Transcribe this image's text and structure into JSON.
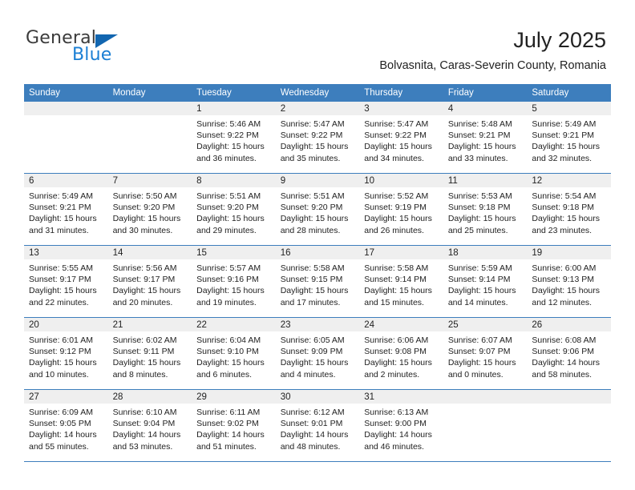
{
  "logo": {
    "word_one": "General",
    "word_two": "Blue",
    "triangle_color": "#1266b0",
    "blue_text_color": "#1b7fd4"
  },
  "header": {
    "title": "July 2025",
    "subtitle": "Bolvasnita, Caras-Severin County, Romania"
  },
  "theme": {
    "header_blue": "#3d7ebd",
    "date_band_gray": "#efefef",
    "text": "#222222"
  },
  "calendar": {
    "day_headers": [
      "Sunday",
      "Monday",
      "Tuesday",
      "Wednesday",
      "Thursday",
      "Friday",
      "Saturday"
    ],
    "weeks": [
      [
        {
          "day": "",
          "empty": true,
          "sunrise": "",
          "sunset": "",
          "daylight_a": "",
          "daylight_b": ""
        },
        {
          "day": "",
          "empty": true,
          "sunrise": "",
          "sunset": "",
          "daylight_a": "",
          "daylight_b": ""
        },
        {
          "day": "1",
          "empty": false,
          "sunrise": "Sunrise: 5:46 AM",
          "sunset": "Sunset: 9:22 PM",
          "daylight_a": "Daylight: 15 hours",
          "daylight_b": "and 36 minutes."
        },
        {
          "day": "2",
          "empty": false,
          "sunrise": "Sunrise: 5:47 AM",
          "sunset": "Sunset: 9:22 PM",
          "daylight_a": "Daylight: 15 hours",
          "daylight_b": "and 35 minutes."
        },
        {
          "day": "3",
          "empty": false,
          "sunrise": "Sunrise: 5:47 AM",
          "sunset": "Sunset: 9:22 PM",
          "daylight_a": "Daylight: 15 hours",
          "daylight_b": "and 34 minutes."
        },
        {
          "day": "4",
          "empty": false,
          "sunrise": "Sunrise: 5:48 AM",
          "sunset": "Sunset: 9:21 PM",
          "daylight_a": "Daylight: 15 hours",
          "daylight_b": "and 33 minutes."
        },
        {
          "day": "5",
          "empty": false,
          "sunrise": "Sunrise: 5:49 AM",
          "sunset": "Sunset: 9:21 PM",
          "daylight_a": "Daylight: 15 hours",
          "daylight_b": "and 32 minutes."
        }
      ],
      [
        {
          "day": "6",
          "empty": false,
          "sunrise": "Sunrise: 5:49 AM",
          "sunset": "Sunset: 9:21 PM",
          "daylight_a": "Daylight: 15 hours",
          "daylight_b": "and 31 minutes."
        },
        {
          "day": "7",
          "empty": false,
          "sunrise": "Sunrise: 5:50 AM",
          "sunset": "Sunset: 9:20 PM",
          "daylight_a": "Daylight: 15 hours",
          "daylight_b": "and 30 minutes."
        },
        {
          "day": "8",
          "empty": false,
          "sunrise": "Sunrise: 5:51 AM",
          "sunset": "Sunset: 9:20 PM",
          "daylight_a": "Daylight: 15 hours",
          "daylight_b": "and 29 minutes."
        },
        {
          "day": "9",
          "empty": false,
          "sunrise": "Sunrise: 5:51 AM",
          "sunset": "Sunset: 9:20 PM",
          "daylight_a": "Daylight: 15 hours",
          "daylight_b": "and 28 minutes."
        },
        {
          "day": "10",
          "empty": false,
          "sunrise": "Sunrise: 5:52 AM",
          "sunset": "Sunset: 9:19 PM",
          "daylight_a": "Daylight: 15 hours",
          "daylight_b": "and 26 minutes."
        },
        {
          "day": "11",
          "empty": false,
          "sunrise": "Sunrise: 5:53 AM",
          "sunset": "Sunset: 9:18 PM",
          "daylight_a": "Daylight: 15 hours",
          "daylight_b": "and 25 minutes."
        },
        {
          "day": "12",
          "empty": false,
          "sunrise": "Sunrise: 5:54 AM",
          "sunset": "Sunset: 9:18 PM",
          "daylight_a": "Daylight: 15 hours",
          "daylight_b": "and 23 minutes."
        }
      ],
      [
        {
          "day": "13",
          "empty": false,
          "sunrise": "Sunrise: 5:55 AM",
          "sunset": "Sunset: 9:17 PM",
          "daylight_a": "Daylight: 15 hours",
          "daylight_b": "and 22 minutes."
        },
        {
          "day": "14",
          "empty": false,
          "sunrise": "Sunrise: 5:56 AM",
          "sunset": "Sunset: 9:17 PM",
          "daylight_a": "Daylight: 15 hours",
          "daylight_b": "and 20 minutes."
        },
        {
          "day": "15",
          "empty": false,
          "sunrise": "Sunrise: 5:57 AM",
          "sunset": "Sunset: 9:16 PM",
          "daylight_a": "Daylight: 15 hours",
          "daylight_b": "and 19 minutes."
        },
        {
          "day": "16",
          "empty": false,
          "sunrise": "Sunrise: 5:58 AM",
          "sunset": "Sunset: 9:15 PM",
          "daylight_a": "Daylight: 15 hours",
          "daylight_b": "and 17 minutes."
        },
        {
          "day": "17",
          "empty": false,
          "sunrise": "Sunrise: 5:58 AM",
          "sunset": "Sunset: 9:14 PM",
          "daylight_a": "Daylight: 15 hours",
          "daylight_b": "and 15 minutes."
        },
        {
          "day": "18",
          "empty": false,
          "sunrise": "Sunrise: 5:59 AM",
          "sunset": "Sunset: 9:14 PM",
          "daylight_a": "Daylight: 15 hours",
          "daylight_b": "and 14 minutes."
        },
        {
          "day": "19",
          "empty": false,
          "sunrise": "Sunrise: 6:00 AM",
          "sunset": "Sunset: 9:13 PM",
          "daylight_a": "Daylight: 15 hours",
          "daylight_b": "and 12 minutes."
        }
      ],
      [
        {
          "day": "20",
          "empty": false,
          "sunrise": "Sunrise: 6:01 AM",
          "sunset": "Sunset: 9:12 PM",
          "daylight_a": "Daylight: 15 hours",
          "daylight_b": "and 10 minutes."
        },
        {
          "day": "21",
          "empty": false,
          "sunrise": "Sunrise: 6:02 AM",
          "sunset": "Sunset: 9:11 PM",
          "daylight_a": "Daylight: 15 hours",
          "daylight_b": "and 8 minutes."
        },
        {
          "day": "22",
          "empty": false,
          "sunrise": "Sunrise: 6:04 AM",
          "sunset": "Sunset: 9:10 PM",
          "daylight_a": "Daylight: 15 hours",
          "daylight_b": "and 6 minutes."
        },
        {
          "day": "23",
          "empty": false,
          "sunrise": "Sunrise: 6:05 AM",
          "sunset": "Sunset: 9:09 PM",
          "daylight_a": "Daylight: 15 hours",
          "daylight_b": "and 4 minutes."
        },
        {
          "day": "24",
          "empty": false,
          "sunrise": "Sunrise: 6:06 AM",
          "sunset": "Sunset: 9:08 PM",
          "daylight_a": "Daylight: 15 hours",
          "daylight_b": "and 2 minutes."
        },
        {
          "day": "25",
          "empty": false,
          "sunrise": "Sunrise: 6:07 AM",
          "sunset": "Sunset: 9:07 PM",
          "daylight_a": "Daylight: 15 hours",
          "daylight_b": "and 0 minutes."
        },
        {
          "day": "26",
          "empty": false,
          "sunrise": "Sunrise: 6:08 AM",
          "sunset": "Sunset: 9:06 PM",
          "daylight_a": "Daylight: 14 hours",
          "daylight_b": "and 58 minutes."
        }
      ],
      [
        {
          "day": "27",
          "empty": false,
          "sunrise": "Sunrise: 6:09 AM",
          "sunset": "Sunset: 9:05 PM",
          "daylight_a": "Daylight: 14 hours",
          "daylight_b": "and 55 minutes."
        },
        {
          "day": "28",
          "empty": false,
          "sunrise": "Sunrise: 6:10 AM",
          "sunset": "Sunset: 9:04 PM",
          "daylight_a": "Daylight: 14 hours",
          "daylight_b": "and 53 minutes."
        },
        {
          "day": "29",
          "empty": false,
          "sunrise": "Sunrise: 6:11 AM",
          "sunset": "Sunset: 9:02 PM",
          "daylight_a": "Daylight: 14 hours",
          "daylight_b": "and 51 minutes."
        },
        {
          "day": "30",
          "empty": false,
          "sunrise": "Sunrise: 6:12 AM",
          "sunset": "Sunset: 9:01 PM",
          "daylight_a": "Daylight: 14 hours",
          "daylight_b": "and 48 minutes."
        },
        {
          "day": "31",
          "empty": false,
          "sunrise": "Sunrise: 6:13 AM",
          "sunset": "Sunset: 9:00 PM",
          "daylight_a": "Daylight: 14 hours",
          "daylight_b": "and 46 minutes."
        },
        {
          "day": "",
          "empty": true,
          "sunrise": "",
          "sunset": "",
          "daylight_a": "",
          "daylight_b": ""
        },
        {
          "day": "",
          "empty": true,
          "sunrise": "",
          "sunset": "",
          "daylight_a": "",
          "daylight_b": ""
        }
      ]
    ]
  }
}
